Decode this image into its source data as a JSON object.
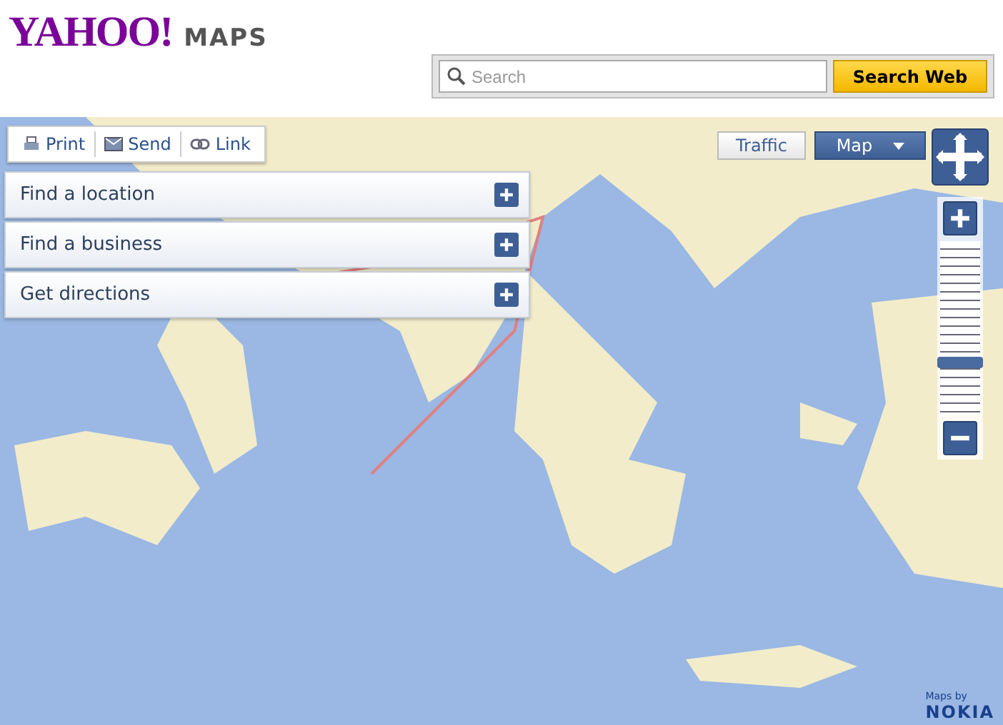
{
  "header": {
    "logo": "YAHOO!",
    "product": "MAPS",
    "search": {
      "placeholder": "Search",
      "button": "Search Web"
    }
  },
  "toolbar": [
    {
      "label": "Print",
      "kind": "print"
    },
    {
      "label": "Send",
      "kind": "send"
    },
    {
      "label": "Link",
      "kind": "link"
    }
  ],
  "panels": [
    {
      "label": "Find a location",
      "expanded": false
    },
    {
      "label": "Find a business",
      "expanded": false
    },
    {
      "label": "Get directions",
      "expanded": false
    }
  ],
  "map_types": [
    {
      "label": "Traffic",
      "selected": false,
      "has_menu": false
    },
    {
      "label": "Map",
      "selected": true,
      "has_menu": true
    }
  ],
  "zoom": {
    "level": 0.3
  },
  "attribution": {
    "prefix": "Maps by",
    "brand": "NOKIA"
  }
}
